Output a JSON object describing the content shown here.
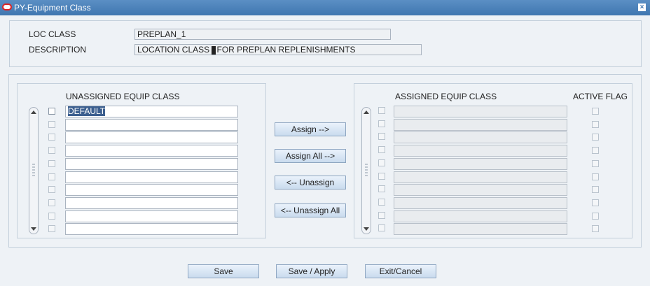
{
  "window": {
    "title": "PY-Equipment Class",
    "close_label": "×"
  },
  "header": {
    "loc_class_label": "LOC CLASS",
    "loc_class_value": "PREPLAN_1",
    "description_label": "DESCRIPTION",
    "description_value_before": "LOCATION CLASS ",
    "description_value_after": "FOR PREPLAN REPLENISHMENTS"
  },
  "unassigned": {
    "heading": "UNASSIGNED EQUIP CLASS",
    "rows": [
      "DEFAULT",
      "",
      "",
      "",
      "",
      "",
      "",
      "",
      "",
      ""
    ]
  },
  "assigned": {
    "heading": "ASSIGNED EQUIP CLASS",
    "active_flag_heading": "ACTIVE FLAG",
    "rows": [
      "",
      "",
      "",
      "",
      "",
      "",
      "",
      "",
      "",
      ""
    ]
  },
  "actions": {
    "assign": "Assign -->",
    "assign_all": "Assign All -->",
    "unassign": "<-- Unassign",
    "unassign_all": "<-- Unassign All"
  },
  "footer": {
    "save": "Save",
    "save_apply": "Save / Apply",
    "exit_cancel": "Exit/Cancel"
  }
}
